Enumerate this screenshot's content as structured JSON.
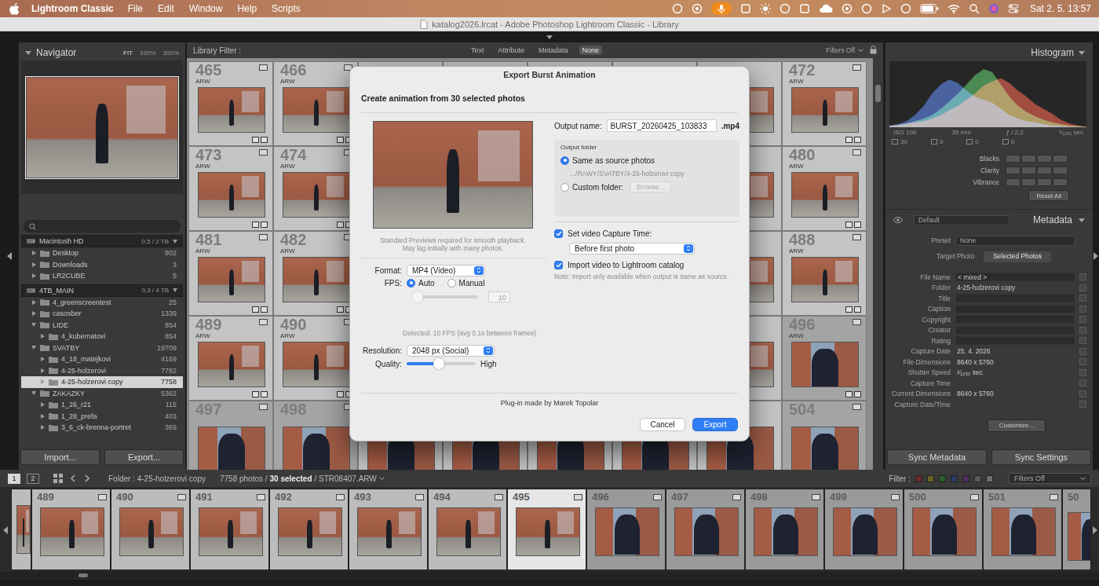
{
  "menubar": {
    "app": "Lightroom Classic",
    "items": [
      "File",
      "Edit",
      "Window",
      "Help",
      "Scripts"
    ],
    "clock": "Sat 2. 5. 13:57"
  },
  "window": {
    "title": "katalog2026.lrcat - Adobe Photoshop Lightroom Classic - Library"
  },
  "navigator": {
    "title": "Navigator",
    "zoom": [
      {
        "label": "FIT",
        "selected": true
      },
      {
        "label": "100%",
        "selected": false
      },
      {
        "label": "300%",
        "selected": false
      }
    ]
  },
  "volumes": [
    {
      "name": "Macintosh HD",
      "usage": "0,5 / 2 TB",
      "expanded": true,
      "folders": [
        {
          "name": "Desktop",
          "count": "802",
          "kind": "top",
          "expanded": false,
          "selected": false
        },
        {
          "name": "Downloads",
          "count": "3",
          "kind": "top",
          "expanded": false,
          "selected": false
        },
        {
          "name": "LR2CUBE",
          "count": "5",
          "kind": "top",
          "expanded": false,
          "selected": false
        }
      ]
    },
    {
      "name": "4TB_MAIN",
      "usage": "0,3 / 4 TB",
      "expanded": true,
      "folders": [
        {
          "name": "4_greenscreentest",
          "count": "25",
          "kind": "top",
          "expanded": false,
          "selected": false
        },
        {
          "name": "casosber",
          "count": "1339",
          "kind": "top",
          "expanded": false,
          "selected": false
        },
        {
          "name": "LIDE",
          "count": "854",
          "kind": "top",
          "expanded": true,
          "selected": false
        },
        {
          "name": "4_kubernatovi",
          "count": "854",
          "kind": "sub",
          "expanded": false,
          "selected": false
        },
        {
          "name": "SVATBY",
          "count": "19709",
          "kind": "top",
          "expanded": true,
          "selected": false
        },
        {
          "name": "4_18_matejkovi",
          "count": "4169",
          "kind": "sub",
          "expanded": false,
          "selected": false
        },
        {
          "name": "4-25-holzerovi",
          "count": "7782",
          "kind": "sub",
          "expanded": false,
          "selected": false
        },
        {
          "name": "4-25-holzerovi copy",
          "count": "7758",
          "kind": "sub",
          "expanded": false,
          "selected": true
        },
        {
          "name": "ZAKAZKY",
          "count": "5362",
          "kind": "top",
          "expanded": true,
          "selected": false
        },
        {
          "name": "1_26_r21",
          "count": "115",
          "kind": "sub",
          "expanded": false,
          "selected": false
        },
        {
          "name": "1_28_prefa",
          "count": "403",
          "kind": "sub",
          "expanded": false,
          "selected": false
        },
        {
          "name": "3_6_ck-brenna-portret",
          "count": "369",
          "kind": "sub",
          "expanded": false,
          "selected": false
        }
      ]
    }
  ],
  "left_buttons": [
    "Import...",
    "Export..."
  ],
  "filter_bar": {
    "label": "Library Filter :",
    "tabs": [
      {
        "label": "Text",
        "selected": false
      },
      {
        "label": "Attribute",
        "selected": false
      },
      {
        "label": "Metadata",
        "selected": false
      },
      {
        "label": "None",
        "selected": true
      }
    ],
    "status": "Filters Off"
  },
  "grid": {
    "rows": [
      {
        "left": [
          {
            "number": "465",
            "badge": "ARW",
            "kind": "wide",
            "selected": true
          },
          {
            "number": "466",
            "badge": "ARW",
            "kind": "wide",
            "selected": true
          }
        ],
        "right": [
          {
            "number": "472",
            "badge": "ARW",
            "kind": "wide",
            "selected": true
          }
        ]
      },
      {
        "left": [
          {
            "number": "473",
            "badge": "ARW",
            "kind": "wide",
            "selected": true
          },
          {
            "number": "474",
            "badge": "ARW",
            "kind": "wide",
            "selected": true
          }
        ],
        "right": [
          {
            "number": "480",
            "badge": "ARW",
            "kind": "wide",
            "selected": true
          }
        ]
      },
      {
        "left": [
          {
            "number": "481",
            "badge": "ARW",
            "kind": "wide",
            "selected": true
          },
          {
            "number": "482",
            "badge": "ARW",
            "kind": "wide",
            "selected": true
          }
        ],
        "right": [
          {
            "number": "488",
            "badge": "ARW",
            "kind": "wide",
            "selected": true
          }
        ]
      },
      {
        "left": [
          {
            "number": "489",
            "badge": "ARW",
            "kind": "wide",
            "selected": true
          },
          {
            "number": "490",
            "badge": "ARW",
            "kind": "wide",
            "selected": true
          }
        ],
        "right": [
          {
            "number": "496",
            "badge": "ARW",
            "kind": "close",
            "selected": false
          }
        ]
      },
      {
        "left": [
          {
            "number": "497",
            "kind": "close",
            "selected": false
          },
          {
            "number": "498",
            "kind": "close",
            "selected": false
          }
        ],
        "right": [
          {
            "number": "504",
            "kind": "close",
            "selected": false
          }
        ]
      }
    ]
  },
  "dialog": {
    "title": "Export Burst Animation",
    "heading": "Create animation from 30 selected photos",
    "preview_note": [
      "Standard Previews required for smooth playback.",
      "May lag initially with many photos."
    ],
    "format": {
      "label": "Format:",
      "value": "MP4 (Video)"
    },
    "fps": {
      "label": "FPS:",
      "options": [
        {
          "label": "Auto",
          "selected": true
        },
        {
          "label": "Manual",
          "selected": false
        }
      ],
      "slider": {
        "level": 0.05,
        "disabled": true
      },
      "field": {
        "value": "10",
        "disabled": true
      }
    },
    "detected": "Detected: 10 FPS (avg 0.1s between frames)",
    "resolution": {
      "label": "Resolution:",
      "value": "2048 px (Social)"
    },
    "quality": {
      "label": "Quality:",
      "level": 0.47,
      "reading": "High"
    },
    "output_name": {
      "label": "Output name:",
      "value": "BURST_20260425_103833",
      "ext": ".mp4"
    },
    "output_folder": {
      "label": "Output folder",
      "options": [
        {
          "label": "Same as source photos",
          "selected": true
        },
        {
          "label": "Custom folder:",
          "selected": false
        }
      ],
      "path": ".../RAWY/SVATBY/4-25-holzerovi copy",
      "browse": {
        "label": "Browse...",
        "disabled": true
      }
    },
    "capture_time": {
      "label": "Set video Capture Time:",
      "checked": true,
      "value": "Before first photo"
    },
    "import": {
      "label": "Import video to Lightroom catalog",
      "checked": true
    },
    "note": "Note: Import only available when output is same as source.",
    "credit": "Plug-in made by Marek Topolar",
    "buttons": [
      {
        "label": "Cancel",
        "default": false
      },
      {
        "label": "Export",
        "default": true
      }
    ]
  },
  "histogram": {
    "title": "Histogram",
    "series": [
      {
        "name": "red",
        "color": "#c8402e",
        "values": [
          0.02,
          0.04,
          0.06,
          0.08,
          0.1,
          0.14,
          0.2,
          0.28,
          0.35,
          0.45,
          0.55,
          0.68,
          0.75,
          0.8,
          0.72,
          0.6,
          0.5,
          0.38,
          0.3,
          0.22,
          0.12,
          0.06,
          0.03,
          0.01
        ]
      },
      {
        "name": "green",
        "color": "#3da24a",
        "values": [
          0.02,
          0.04,
          0.06,
          0.1,
          0.14,
          0.2,
          0.3,
          0.42,
          0.55,
          0.7,
          0.85,
          0.95,
          0.9,
          0.7,
          0.5,
          0.35,
          0.25,
          0.18,
          0.12,
          0.08,
          0.05,
          0.03,
          0.02,
          0.01
        ]
      },
      {
        "name": "blue",
        "color": "#3d62c8",
        "values": [
          0.03,
          0.05,
          0.1,
          0.2,
          0.35,
          0.55,
          0.7,
          0.78,
          0.72,
          0.6,
          0.5,
          0.45,
          0.4,
          0.3,
          0.2,
          0.14,
          0.1,
          0.08,
          0.05,
          0.03,
          0.02,
          0.01,
          0.01,
          0
        ]
      }
    ],
    "info": [
      "ISO 100",
      "35 mm",
      "ƒ / 2,2",
      "¹⁄₁₂₅₀ sec"
    ],
    "counts": [
      "30",
      "0",
      "0",
      "0"
    ]
  },
  "quick_develop": {
    "rows": [
      "Blacks",
      "Clarity",
      "Vibrance"
    ],
    "reset": "Reset All"
  },
  "metadata": {
    "title": "Metadata",
    "preset_set": "Default",
    "preset_label": "Preset",
    "preset": "None",
    "targets": [
      {
        "label": "Target Photo",
        "selected": false
      },
      {
        "label": "Selected Photos",
        "selected": true
      }
    ],
    "fields": [
      {
        "label": "File Name",
        "value": "< mixed >",
        "kind": "field"
      },
      {
        "label": "Folder",
        "value": "4-25-holzerovi copy",
        "kind": "info"
      },
      {
        "label": "Title",
        "kind": "field"
      },
      {
        "label": "Caption",
        "kind": "field"
      },
      {
        "label": "Copyright",
        "kind": "field"
      },
      {
        "label": "Creator",
        "kind": "field"
      },
      {
        "label": "Rating",
        "kind": "field"
      },
      {
        "label": "Capture Date",
        "value": "25. 4. 2026",
        "kind": "info"
      },
      {
        "label": "File Dimensions",
        "value": "8640 x 5760",
        "kind": "info"
      },
      {
        "label": "Shutter Speed",
        "value": "¹⁄₁₂₅₀ sec",
        "kind": "info"
      },
      {
        "label": "Capture Time",
        "kind": "info"
      },
      {
        "label": "Current Dimensions",
        "value": "8640 x 5760",
        "kind": "info"
      },
      {
        "label": "Capture Date/Time",
        "kind": "info"
      }
    ],
    "customize": "Customize..."
  },
  "sync_buttons": [
    "Sync Metadata",
    "Sync Settings"
  ],
  "toolbar": {
    "views": [
      {
        "label": "1",
        "selected": true
      },
      {
        "label": "2",
        "selected": false
      }
    ],
    "folder": "Folder : 4-25-holzerovi copy",
    "status": [
      "7758 photos /",
      "30 selected",
      "/ STR08407.ARW"
    ],
    "filter_label": "Filter :",
    "labels": [
      {
        "color": "#6a2a26"
      },
      {
        "color": "#6a6326"
      },
      {
        "color": "#2c5e2c"
      },
      {
        "color": "#2a3c66"
      },
      {
        "color": "#4f2c62"
      },
      {
        "color": "#5a5a5a"
      },
      {
        "color": "#6e6e6e"
      }
    ],
    "filter_value": "Filters Off"
  },
  "filmstrip": {
    "cells": [
      {
        "number": "489",
        "kind": "wide",
        "selected": true,
        "active": false
      },
      {
        "number": "490",
        "kind": "wide",
        "selected": true,
        "active": false
      },
      {
        "number": "491",
        "kind": "wide",
        "selected": true,
        "active": false
      },
      {
        "number": "492",
        "kind": "wide",
        "selected": true,
        "active": false
      },
      {
        "number": "493",
        "kind": "wide",
        "selected": true,
        "active": false
      },
      {
        "number": "494",
        "kind": "wide",
        "selected": true,
        "active": false
      },
      {
        "number": "495",
        "kind": "wide",
        "selected": true,
        "active": true
      },
      {
        "number": "496",
        "kind": "close",
        "selected": false,
        "active": false
      },
      {
        "number": "497",
        "kind": "close",
        "selected": false,
        "active": false
      },
      {
        "number": "498",
        "kind": "close",
        "selected": false,
        "active": false
      },
      {
        "number": "499",
        "kind": "close",
        "selected": false,
        "active": false
      },
      {
        "number": "500",
        "kind": "close",
        "selected": false,
        "active": false
      },
      {
        "number": "501",
        "kind": "close",
        "selected": false,
        "active": false
      }
    ],
    "partial": "50"
  }
}
